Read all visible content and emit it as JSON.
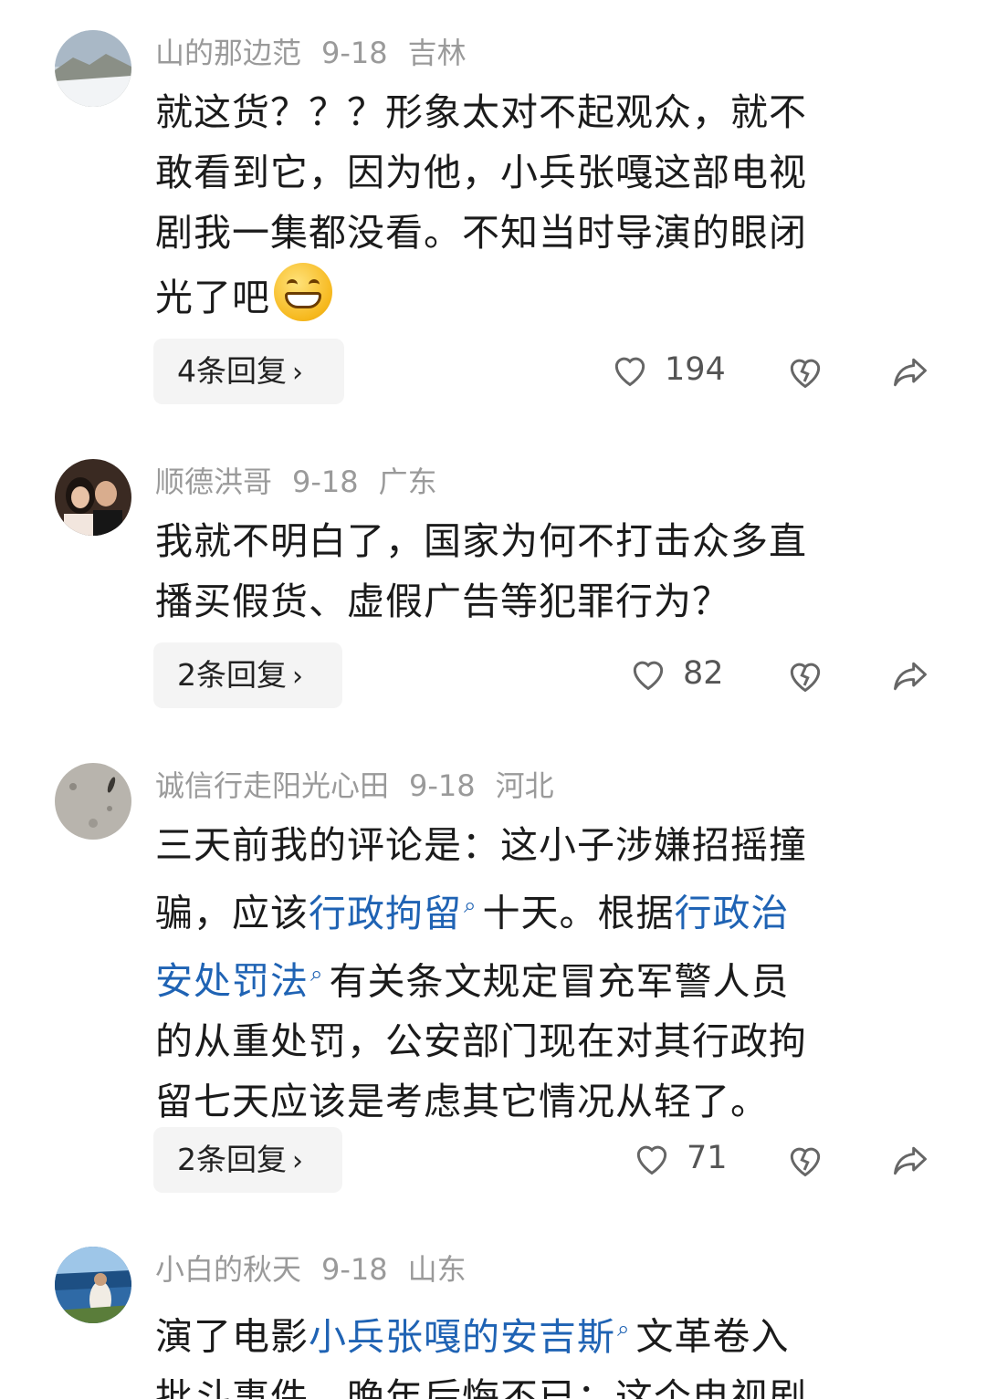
{
  "comments": [
    {
      "user": "山的那边范",
      "date": "9-18",
      "location": "吉林",
      "text_lines": [
        "就这货？？？形象太对不起观众，就不",
        "敢看到它，因为他，小兵张嘎这部电视",
        "剧我一集都没看。不知当时导演的眼闭",
        "光了吧"
      ],
      "emoji": "grinning-face",
      "replies": "4条回复",
      "likes": "194"
    },
    {
      "user": "顺德洪哥",
      "date": "9-18",
      "location": "广东",
      "text_lines": [
        "我就不明白了，国家为何不打击众多直",
        "播买假货、虚假广告等犯罪行为？"
      ],
      "replies": "2条回复",
      "likes": "82"
    },
    {
      "user": "诚信行走阳光心田",
      "date": "9-18",
      "location": "河北",
      "text": {
        "l1": "三天前我的评论是：这小子涉嫌招摇撞",
        "l2a": "骗，应该",
        "link1": "行政拘留",
        "l2b": "十天。根据",
        "link2a": "行政治",
        "link2b": "安处罚法",
        "l3": "有关条文规定冒充军警人员",
        "l4": "的从重处罚，公安部门现在对其行政拘",
        "l5": "留七天应该是考虑其它情况从轻了。"
      },
      "replies": "2条回复",
      "likes": "71"
    },
    {
      "user": "小白的秋天",
      "date": "9-18",
      "location": "山东",
      "text": {
        "l1a": "演了电影",
        "link1": "小兵张嘎的安吉斯",
        "l1b": "文革卷入",
        "l2": "批斗事件，晚年后悔不已；这个电视剧"
      }
    }
  ],
  "icons": {
    "like": "heart-outline-icon",
    "dislike": "broken-heart-icon",
    "share": "share-arrow-icon",
    "search_hint": "search-magnifier-icon"
  },
  "colors": {
    "link": "#1f63b4",
    "meta": "#9a9a9a",
    "reply_bg": "#f4f4f4"
  }
}
